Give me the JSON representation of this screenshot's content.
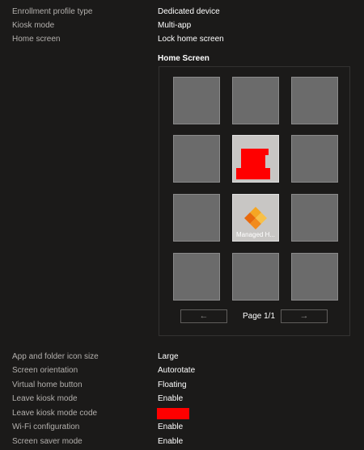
{
  "settings_top": [
    {
      "label": "Enrollment profile type",
      "value": "Dedicated device"
    },
    {
      "label": "Kiosk mode",
      "value": "Multi-app"
    },
    {
      "label": "Home screen",
      "value": "Lock home screen"
    }
  ],
  "home_screen": {
    "title": "Home Screen",
    "app_label": "Managed H...",
    "page_label": "Page 1/1",
    "prev_symbol": "←",
    "next_symbol": "→",
    "redaction_color": "#ff0000"
  },
  "settings_bottom": [
    {
      "label": "App and folder icon size",
      "value": "Large"
    },
    {
      "label": "Screen orientation",
      "value": "Autorotate"
    },
    {
      "label": "Virtual home button",
      "value": "Floating"
    },
    {
      "label": "Leave kiosk mode",
      "value": "Enable"
    },
    {
      "label": "Leave kiosk mode code",
      "value": ""
    },
    {
      "label": "Wi-Fi configuration",
      "value": "Enable"
    },
    {
      "label": "Screen saver mode",
      "value": "Enable"
    }
  ]
}
